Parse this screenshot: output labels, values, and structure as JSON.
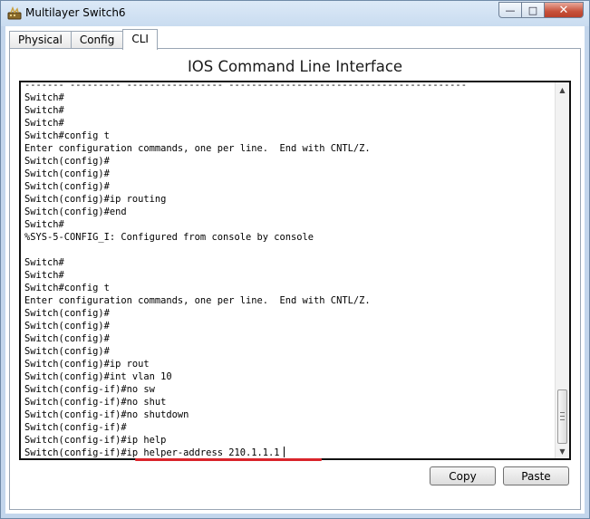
{
  "window": {
    "title": "Multilayer Switch6",
    "icon": "router-icon",
    "controls": {
      "minimize": "—",
      "maximize": "□",
      "close": "✕"
    }
  },
  "tabs": [
    {
      "label": "Physical",
      "active": false
    },
    {
      "label": "Config",
      "active": false
    },
    {
      "label": "CLI",
      "active": true
    }
  ],
  "cli": {
    "heading": "IOS Command Line Interface",
    "lines": [
      "------- --------- ----------------- ------------------------------------------",
      "Switch#",
      "Switch#",
      "Switch#",
      "Switch#config t",
      "Enter configuration commands, one per line.  End with CNTL/Z.",
      "Switch(config)#",
      "Switch(config)#",
      "Switch(config)#",
      "Switch(config)#ip routing",
      "Switch(config)#end",
      "Switch#",
      "%SYS-5-CONFIG_I: Configured from console by console",
      "",
      "Switch#",
      "Switch#",
      "Switch#config t",
      "Enter configuration commands, one per line.  End with CNTL/Z.",
      "Switch(config)#",
      "Switch(config)#",
      "Switch(config)#",
      "Switch(config)#",
      "Switch(config)#ip rout",
      "Switch(config)#int vlan 10",
      "Switch(config-if)#no sw",
      "Switch(config-if)#no shut",
      "Switch(config-if)#no shutdown",
      "Switch(config-if)#",
      "Switch(config-if)#ip help",
      "Switch(config-if)#ip helper-address 210.1.1.1"
    ],
    "highlight_color": "#d9242a"
  },
  "buttons": {
    "copy": "Copy",
    "paste": "Paste"
  }
}
